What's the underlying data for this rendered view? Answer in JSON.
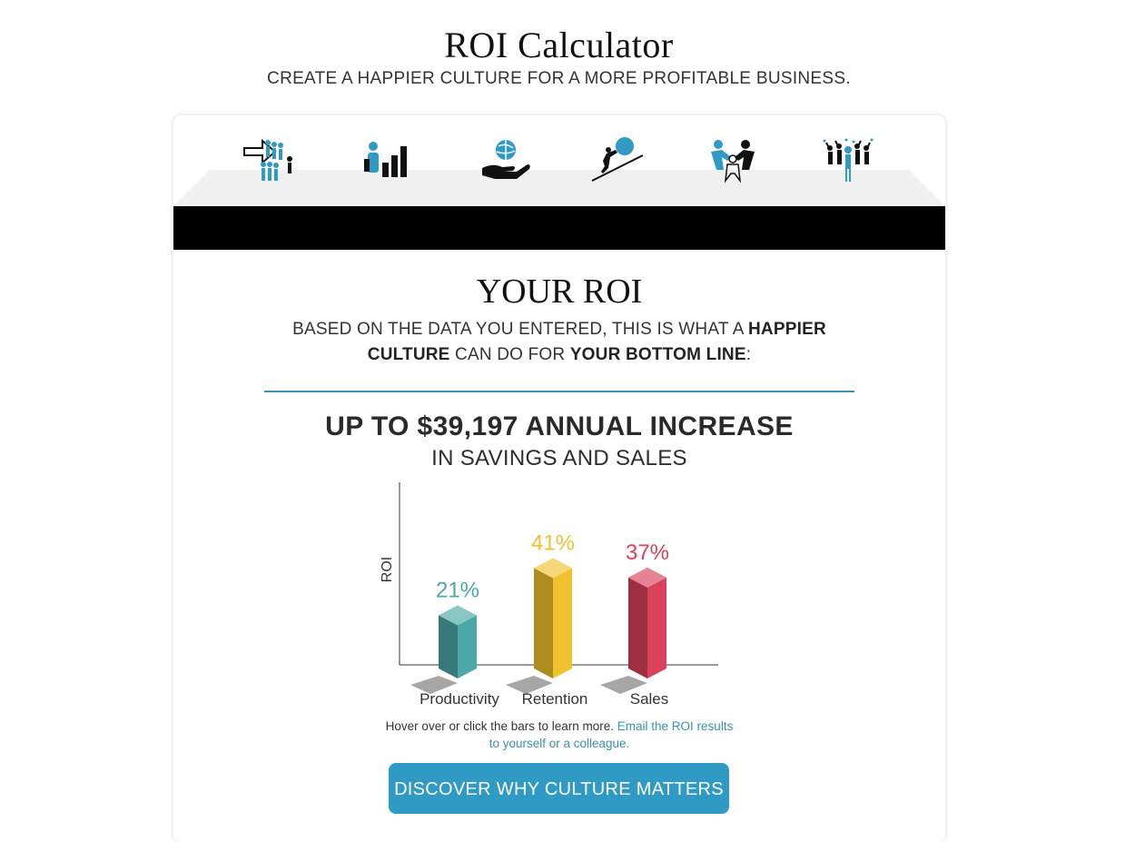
{
  "header": {
    "title": "ROI Calculator",
    "subtitle": "CREATE A HAPPIER CULTURE FOR A MORE PROFITABLE BUSINESS."
  },
  "steps": [
    {
      "icon": "team-line-icon"
    },
    {
      "icon": "growth-chart-icon"
    },
    {
      "icon": "hand-globe-icon"
    },
    {
      "icon": "push-uphill-icon"
    },
    {
      "icon": "helping-people-icon"
    },
    {
      "icon": "celebrating-crowd-icon"
    }
  ],
  "results": {
    "title": "YOUR ROI",
    "desc_1": "BASED ON THE DATA YOU ENTERED, THIS IS WHAT A ",
    "desc_2": "HAPPIER CULTURE",
    "desc_3": " CAN DO FOR ",
    "desc_4": "YOUR BOTTOM LINE",
    "desc_5": ":",
    "headline": "UP TO $39,197 ANNUAL INCREASE",
    "subheadline": "IN SAVINGS AND SALES"
  },
  "chart_data": {
    "type": "bar",
    "categories": [
      "Productivity",
      "Retention",
      "Sales"
    ],
    "values": [
      21,
      41,
      37
    ],
    "value_labels": [
      "21%",
      "41%",
      "37%"
    ],
    "ylabel": "ROI",
    "xlabel": "",
    "colors": [
      "#4aa9a6",
      "#f2c12e",
      "#d9415c"
    ]
  },
  "note": {
    "text": "Hover over or click the bars to learn more. ",
    "link": "Email the ROI results to yourself or a colleague."
  },
  "cta": {
    "label": "DISCOVER WHY CULTURE MATTERS"
  }
}
